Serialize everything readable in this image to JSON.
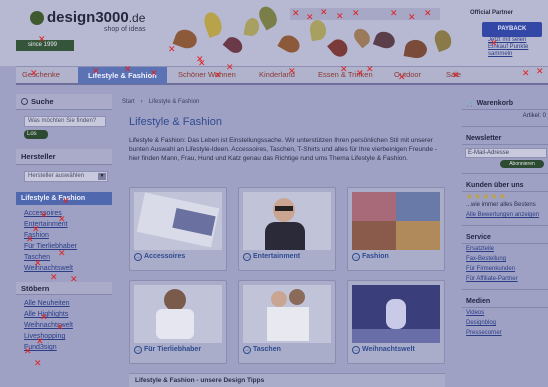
{
  "header": {
    "logo_name": "design3000",
    "logo_tld": ".de",
    "logo_tagline": "shop of ideas",
    "since": "since 1999",
    "partner_title": "Official Partner",
    "payback_label": "PAYBACK",
    "partner_links": [
      "Jetzt mit selen",
      "Einkauf Punkte",
      "sammeln"
    ]
  },
  "nav": {
    "tabs": [
      "Geschenke",
      "Lifestyle & Fashion",
      "Schöner Wohnen",
      "Kinderland",
      "Essen & Trinken",
      "Outdoor",
      "Sale"
    ]
  },
  "sidebar": {
    "search_title": "Suche",
    "search_placeholder": "Was möchten Sie finden?",
    "go_label": "Los",
    "brand_title": "Hersteller",
    "brand_select": "Hersteller auswählen",
    "active_category": "Lifestyle & Fashion",
    "category_links": [
      "Accessoires",
      "Entertainment",
      "Fashion",
      "Für Tierliebhaber",
      "Taschen",
      "Weihnachtswelt"
    ],
    "browse_title": "Stöbern",
    "browse_links": [
      "Alle Neuheiten",
      "Alle Highlights",
      "Weihnachtswelt",
      "Liveshopping",
      "Fund3sign"
    ]
  },
  "main": {
    "breadcrumb": [
      "Start",
      "Lifestyle & Fashion"
    ],
    "title": "Lifestyle & Fashion",
    "intro": "Lifestyle & Fashion: Das Leben ist Einstellungssache. Wir unterstützen Ihren persönlichen Stil mit unserer bunten Auswahl an Lifestyle-Ideen. Accessoires, Taschen, T-Shirts und alles für Ihre vierbeinigen Freunde - hier finden Mann, Frau, Hund und Katz genau das Richtige rund ums Thema Lifestyle & Fashion.",
    "tiles": [
      "Accessoires",
      "Entertainment",
      "Fashion",
      "Für Tierliebhaber",
      "Taschen",
      "Weihnachtswelt"
    ],
    "tips_title": "Lifestyle & Fashion - unsere Design Tipps"
  },
  "right": {
    "cart_title": "Warenkorb",
    "cart_items": "Artikel: 0",
    "newsletter_title": "Newsletter",
    "newsletter_placeholder": "E-Mail-Adresse",
    "newsletter_btn": "Abonnieren",
    "reviews_title": "Kunden über uns",
    "reviews_text": "...wie immer alles Bestens",
    "reviews_link": "Alle Bewertungen anzeigen",
    "service_title": "Service",
    "service_links": [
      "Ersatzteile",
      "Fax-Bestellung",
      "Für Firmenkunden",
      "Für Affiliate-Partner"
    ],
    "media_title": "Medien",
    "media_links": [
      "Videos",
      "Designblog",
      "Pressecorner"
    ]
  },
  "colors": {
    "accent": "#5b73b5",
    "nav_text": "#8a3a35",
    "link": "#2b3d86",
    "marker": "#e02020"
  }
}
